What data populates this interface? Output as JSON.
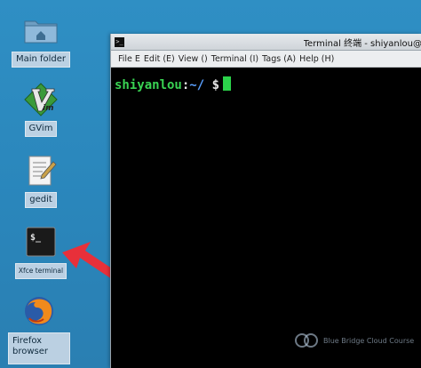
{
  "desktop": {
    "icons": [
      {
        "id": "main-folder",
        "label": "Main folder",
        "icon": "folder-home-icon"
      },
      {
        "id": "gvim",
        "label": "GVim",
        "icon": "vim-icon"
      },
      {
        "id": "gedit",
        "label": "gedit",
        "icon": "text-editor-icon"
      },
      {
        "id": "xfce-terminal",
        "label": "Xfce terminal",
        "icon": "terminal-icon"
      },
      {
        "id": "firefox",
        "label": "Firefox browser",
        "icon": "firefox-icon"
      }
    ]
  },
  "terminal": {
    "title": "Terminal 终端 - shiyanlou@",
    "menu": [
      "File E",
      "Edit (E)",
      "View ()",
      "Terminal (I)",
      "Tags (A)",
      "Help (H)"
    ],
    "prompt": {
      "user": "shiyanlou",
      "separator": ":",
      "path": "~/",
      "symbol": "$"
    },
    "icon_glyph": ">_"
  },
  "watermark": {
    "text": "Blue Bridge Cloud Course"
  },
  "colors": {
    "desktop_bg": "#2f8fc4",
    "terminal_bg": "#000000",
    "prompt_user": "#39d353",
    "arrow": "#e8303a"
  }
}
